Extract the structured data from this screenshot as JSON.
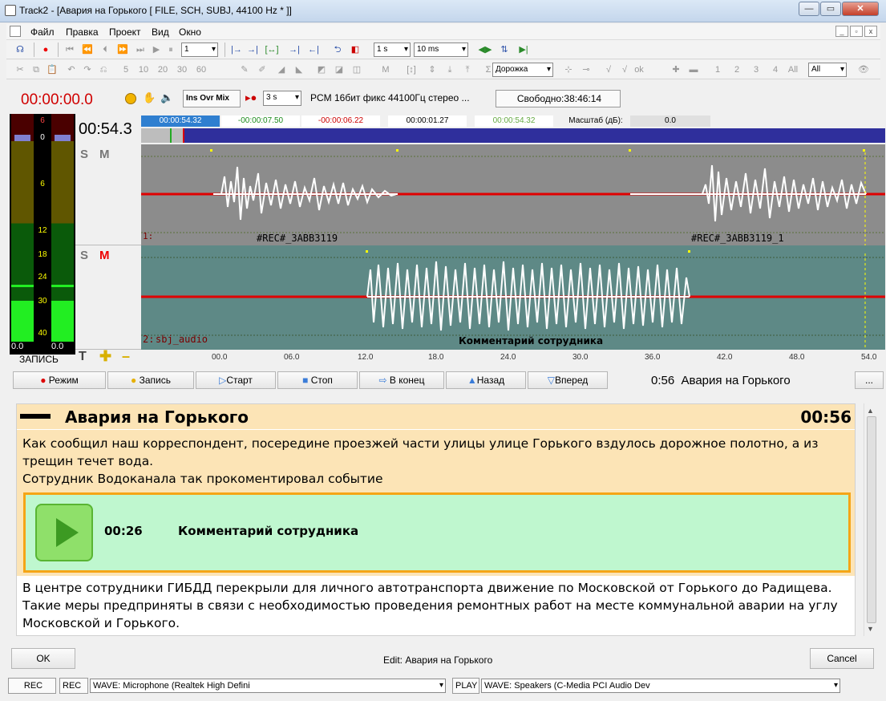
{
  "window": {
    "title": "Track2 - [Авария на Горького [ FILE, SCH, SUBJ, 44100 Hz * ]]",
    "min": "—",
    "max": "▭",
    "close": "✕"
  },
  "menu": [
    "Файл",
    "Правка",
    "Проект",
    "Вид",
    "Окно"
  ],
  "toolbar1": {
    "rec_sel": "1",
    "step": "1 s",
    "ms": "10 ms"
  },
  "toolbar2": {
    "n5": "5",
    "n10": "10",
    "n20": "20",
    "n30": "30",
    "n60": "60",
    "m": "M",
    "track_mode": "Дорожка",
    "t1": "1",
    "t2": "2",
    "t3": "3",
    "t4": "4",
    "all_gray": "All",
    "all_sel": "All"
  },
  "transport": {
    "time": "00:00:00.0",
    "modes": {
      "ins": "Ins",
      "ovr": "Ovr",
      "mix": "Mix"
    },
    "pre": "3 s",
    "format": "PCM 16бит фикс 44100Гц стерео",
    "more": "...",
    "free": "Свободно:38:46:14"
  },
  "position": {
    "big": "00:54.3",
    "cur": "00:00:54.32",
    "left": "-00:00:07.50",
    "right": "-00:00:06.22",
    "sel": "00:00:01.27",
    "end": "00:00:54.32",
    "scale_label": "Масштаб (дБ):",
    "scale_val": "0.0"
  },
  "meters": {
    "labels": [
      "6",
      "0",
      "6",
      "12",
      "18",
      "24",
      "30",
      "40"
    ],
    "l": "0.0",
    "r": "0.0",
    "rec_label": "ЗАПИСЬ"
  },
  "tracks": [
    {
      "s": "S",
      "m": "M",
      "num": "1:",
      "clips": [
        "#REC#_3ABB3119",
        "#REC#_3ABB3119_1"
      ]
    },
    {
      "s": "S",
      "m": "M",
      "num": "2:",
      "name": "sbj_audio",
      "clip": "Комментарий сотрудника"
    }
  ],
  "ruler": [
    "00.0",
    "06.0",
    "12.0",
    "18.0",
    "24.0",
    "30.0",
    "36.0",
    "42.0",
    "48.0",
    "54.0"
  ],
  "buttons": {
    "mode": "Режим",
    "rec": "Запись",
    "start": "Старт",
    "stop": "Стоп",
    "toend": "В конец",
    "back": "Назад",
    "fwd": "Вперед",
    "now": "0:56  Авария на Горького",
    "dots": "..."
  },
  "story": {
    "title": "Авария на Горького",
    "dur": "00:56",
    "p1": "Как сообщил наш корреспондент, посередине проезжей части улицы улице Горького вздулось дорожное полотно, а из трещин течет вода.",
    "p2": "Сотрудник  Водоканала так прокоментировал событие",
    "clip_time": "00:26",
    "clip_title": "Комментарий сотрудника",
    "p3": "В центре сотрудники ГИБДД перекрыли для личного автотранспорта движение по Московской от Горького до Радищева. Такие меры предприняты в связи с необходимостью проведения ремонтных работ на месте коммунальной аварии на углу Московской и Горького."
  },
  "footer": {
    "ok": "OK",
    "edit": "Edit: Авария на Горького",
    "cancel": "Cancel"
  },
  "status": {
    "rec1": "REC",
    "rec2": "REC",
    "in_dev": "WAVE: Microphone (Realtek High Defini",
    "play": "PLAY",
    "out_dev": "WAVE: Speakers (C-Media PCI Audio Dev"
  }
}
